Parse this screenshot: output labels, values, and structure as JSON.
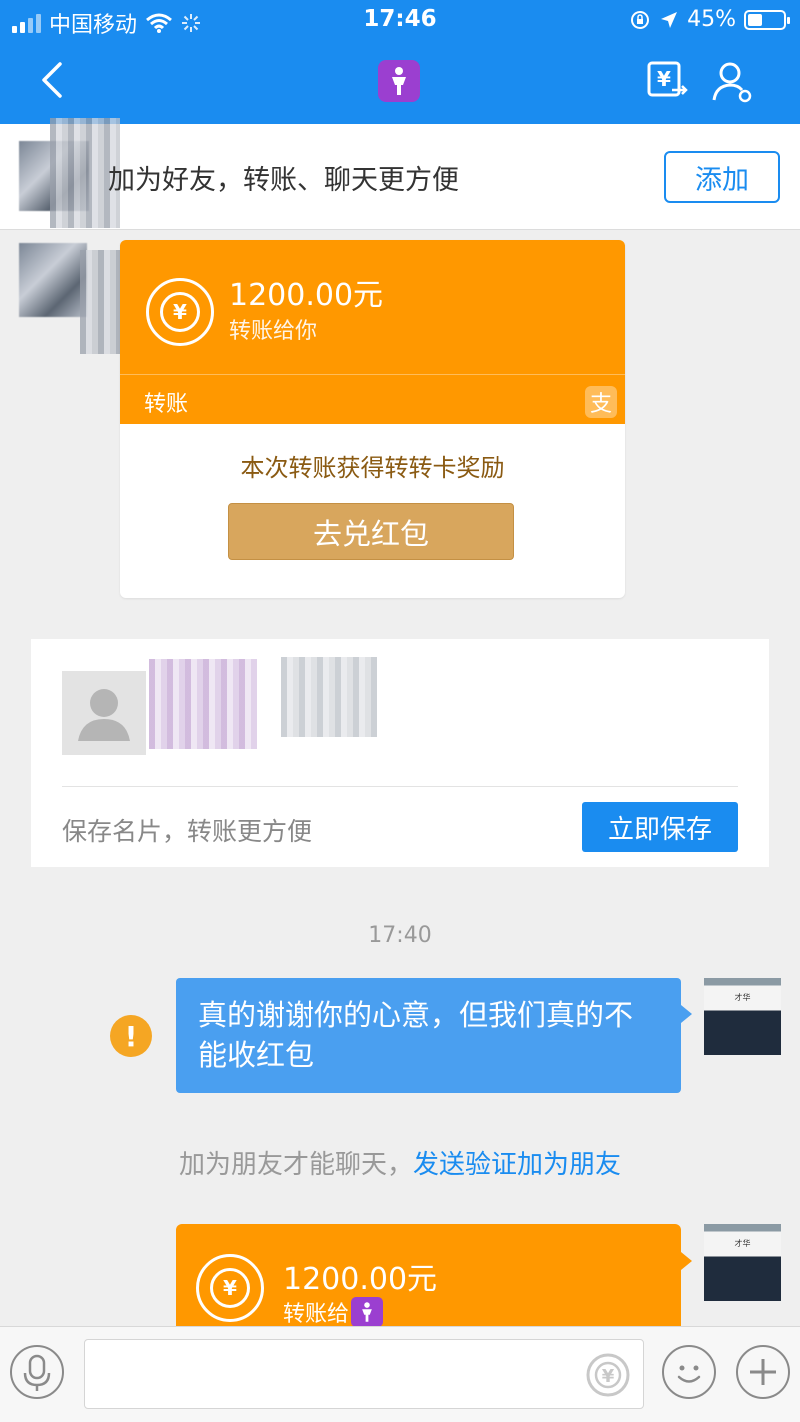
{
  "status_bar": {
    "carrier": "中国移动",
    "time": "17:46",
    "battery": "45%"
  },
  "friend_bar": {
    "text": "加为好友，转账、聊天更方便",
    "add_label": "添加"
  },
  "transfer_card": {
    "amount": "1200.00元",
    "subtitle": "转账给你",
    "label": "转账",
    "reward_text": "本次转账获得转转卡奖励",
    "redeem_label": "去兑红包"
  },
  "contact_card": {
    "save_text": "保存名片，转账更方便",
    "save_label": "立即保存"
  },
  "messages": {
    "timestamp": "17:40",
    "bubble_text": "真的谢谢你的心意，但我们真的不能收红包",
    "avatar_caption": "才华"
  },
  "notice": {
    "text": "加为朋友才能聊天，",
    "link": "发送验证加为朋友"
  },
  "transfer_card2": {
    "amount": "1200.00元",
    "subtitle": "转账给"
  },
  "input_bar": {
    "placeholder": ""
  },
  "colors": {
    "primary_blue": "#1a8cf0",
    "transfer_orange": "#ff9800",
    "bubble_blue": "#4a9ff0",
    "redeem_gold": "#d8a65d",
    "warning": "#f5a623"
  },
  "icons": [
    "back-arrow-icon",
    "person-icon",
    "yuan-transfer-icon",
    "profile-settings-icon",
    "yuan-icon",
    "alipay-icon",
    "warning-icon",
    "mic-icon",
    "emoji-icon",
    "plus-icon"
  ]
}
